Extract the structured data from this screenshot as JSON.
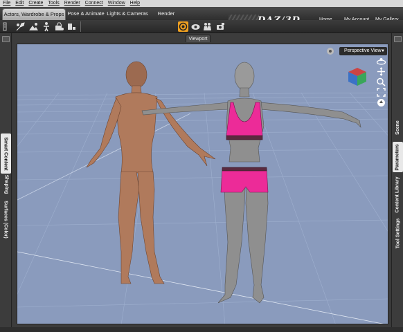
{
  "menu": [
    "File",
    "Edit",
    "Create",
    "Tools",
    "Render",
    "Connect",
    "Window",
    "Help"
  ],
  "tabs": {
    "actors": "Actors, Wardrobe & Props",
    "pose": "Pose & Animate",
    "lights": "Lights & Cameras",
    "render": "Render"
  },
  "logo": {
    "left": "DAZ",
    "right": "3D"
  },
  "top_links": {
    "home": "Home",
    "account": "My Account",
    "gallery": "My Gallery"
  },
  "viewport": {
    "tab_label": "Viewport",
    "camera": "Perspective View"
  },
  "left_tabs": {
    "smart_content": "Smart Content",
    "shaping": "Shaping",
    "surfaces": "Surfaces (Color)"
  },
  "right_tabs": {
    "scene": "Scene",
    "parameters": "Parameters",
    "content_library": "Content Library",
    "tool_settings": "Tool Settings"
  },
  "colors": {
    "viewport_bg": "#8a9bbd",
    "active_tool": "#f0a020",
    "bikini": "#ec2b98",
    "skin": "#b07a5c",
    "gray_figure": "#8f8f8f"
  }
}
